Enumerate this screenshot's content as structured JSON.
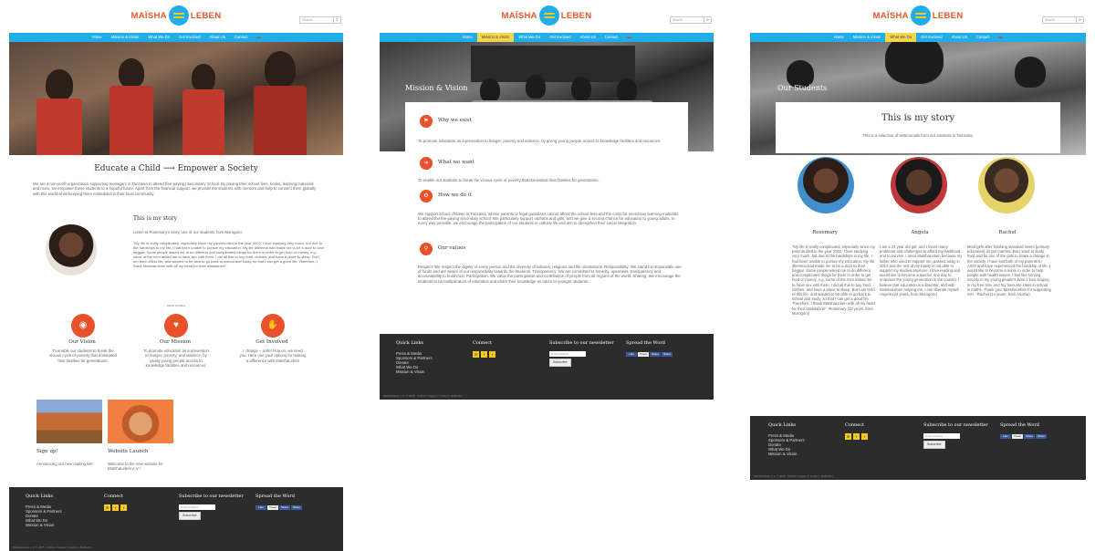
{
  "brand": {
    "left": "MAÏSHA",
    "right": "LEBEN"
  },
  "search": {
    "placeholder": "Search...",
    "icon": "search-icon"
  },
  "nav": [
    "Home",
    "Mission & Vision",
    "What We Do",
    "Get Involved",
    "About Us",
    "Contact"
  ],
  "colors": {
    "accent": "#21aee8",
    "orange": "#e8512a",
    "yellow": "#f5c81e",
    "footer": "#2c2c2c"
  },
  "home": {
    "headline": "Educate a Child ⟶ Empower a Society",
    "intro": "We are a non-profit organization supporting teenagers in Tanzania to attend (fee-paying) Secondary School. By paying their school fees, books, learning materials and more, we empower these students to a hopeful future. Apart from the financial support, we provide the students with mentors and help to connect them globally with this world while keeping them embedded in their local community.",
    "story_title": "This is my story",
    "story_lead": "Listen to Rosemary's story, one of our students from Morogoro:",
    "story_text": "\"My life is really complicated, especially since my parents died in the year 2002. I love studying very much, but due to the hardships in my life, I had been unable to pursue my education. My life dilemma had made me to be a door to door beggar. Some people asked me to do different and complicated things for them in order to get food or money, e.g. some of the men asked me to have sex with them. I did all this to buy food, clothes, and have a place to sleep. But I am tired of this life, and wanted to be able to go back to school and study, so that I can get a good life. Therefore, I thank MaïshaLeben with all my heart for their assistance!\"",
    "read_more": "READ MORE ▸",
    "features": [
      {
        "title": "Our Vision",
        "text": "To enable our students to break the vicious cycle of poverty that dominated their families for generations.",
        "icon": "eye-icon"
      },
      {
        "title": "Our Mission",
        "text": "To promote education as a prevention to hunger, poverty, and violence, by giving young people access to knowledge facilities and resources.",
        "icon": "heart-icon"
      },
      {
        "title": "Get Involved",
        "text": "I change – a life! Hop on, we need you. Here one your options for making a difference with MaïshaLeben",
        "icon": "thumbs-up-icon"
      }
    ],
    "news": [
      {
        "title": "Sign up!",
        "text": "Announcing our new mailing list!"
      },
      {
        "title": "Website Launch",
        "text": "Welcome to the new website for MaïshaLeben e.V.!"
      }
    ]
  },
  "mission": {
    "hero_title": "Mission & Vision",
    "values": [
      {
        "title": "Why we exist",
        "text": "To promote education as a prevention to hunger, poverty and violence, by giving young people access to knowledge facilities and resources.",
        "icon": "flag-icon"
      },
      {
        "title": "What we want",
        "text": "To enable our students to break the vicious cycle of poverty that dominated their families for generations.",
        "icon": "arrow-icon"
      },
      {
        "title": "How we do it",
        "text": "We support school children in Tanzania, whose parents or legal guardians cannot afford the school fees and the costs for necessary learning materials to attend the fee-paying secondary school. We particularly support orphans and girls, and we give a second chance for education to young adults. In every way possible, we encourage the participation of our students in cultural life and aim to strengthen their social integration.",
        "icon": "gear-icon"
      },
      {
        "title": "Our values",
        "text": "Respect: We respect the dignity of every person and the diversity of cultures, religions and life orientations. Responsibility: We stand for responsible use of funds and are aware of our responsibility towards the students. Transparency: We are committed to honesty, openness, transparency and accountability to build trust. Participation: We value the participation and contribution of people from all regions of the world. Sharing: We encourage the students to be multiplicators of education and share their knowledge as tutors to younger students.",
        "icon": "magnifier-icon"
      }
    ]
  },
  "students": {
    "hero_title": "Our Students",
    "title": "This is my story",
    "subtitle": "This is a selection of testimonials from our students in Tanzania.",
    "people": [
      {
        "name": "Rosemary",
        "text": "\"My life is really complicated, especially since my parents died in the year 2002. I love studying very much, but due to the hardships in my life, I had been unable to pursue my education. My life dilemma had made me to be a door to door beggar. Some people asked me to do different and complicated things for them in order to get food or money, e.g. some of the men asked me to have sex with them. I did all this to buy food, clothes, and have a place to sleep. But I am tired of this life, and wanted to be able to go back to school and study, so that I can get a good life. Therefore, I thank MaïshaLeben with all my heart for their assistance!\" -Rosemary (19 years, from Morogoro)"
      },
      {
        "name": "Angela",
        "text": "I am a 24 year old girl, and I faced many problems and challenges to afford my livelihood and to survive. I need MaïshaLeben because my father who used to support me, passed away in 2012 and the rest of my family is not able to support my studies anymore. I love reading and would like to become a teacher one day to empower the young generation in the country. I believe that education is a liberator, and with MaïshaLeben helping me, I can liberate myself. - Angela (24 years, from Morogoro)"
      },
      {
        "name": "Rachel",
        "text": "Most girls after finishing standard seven [primary education] do get married. But I want to study hard and be one of the girls to make a change in the society. I have lost both of my parents to AIDS and have experienced the hardship of life. I would like to become a nurse in order to help people with health issues. I feel like serving society in my young people's lives. I love singing in my free time and my favourite class in school is maths. Thank you, MaïshaLeben for supporting me! - Rachel (14 years, from Arusha)"
      }
    ]
  },
  "footer": {
    "quick_title": "Quick Links",
    "quick_links": [
      "Press & Media",
      "Sponsors & Partners",
      "Donate",
      "What We Do",
      "Mission & Vision"
    ],
    "connect_title": "Connect",
    "subscribe_title": "Subscribe to our newsletter",
    "subscribe_placeholder": "Email Address",
    "subscribe_button": "Subscribe",
    "spread_title": "Spread the Word",
    "share": [
      "Like",
      "Tweet",
      "Share",
      "Share"
    ],
    "copyright": "MaïshaLeben e.V. © 2015 · Kitchen Images © Curtis J. McMahon"
  }
}
